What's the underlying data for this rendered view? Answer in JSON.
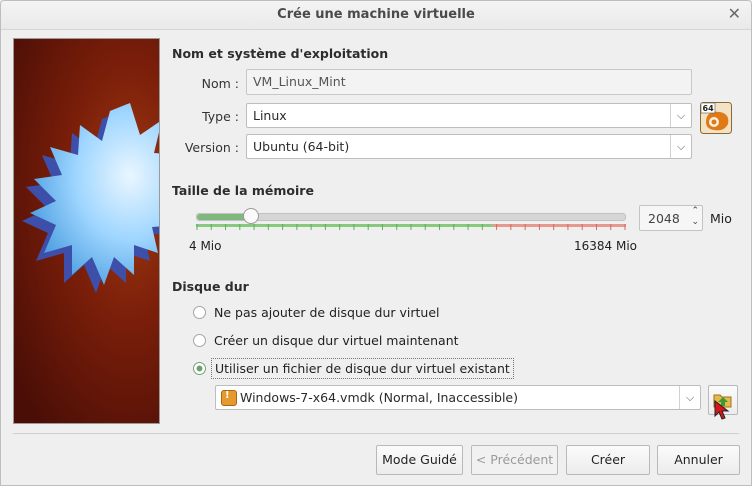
{
  "window": {
    "title": "Crée une machine virtuelle"
  },
  "sections": {
    "os": "Nom et système d'exploitation",
    "memory": "Taille de la mémoire",
    "disk": "Disque dur"
  },
  "name": {
    "label": "Nom :",
    "value": "VM_Linux_Mint"
  },
  "type": {
    "label": "Type :",
    "value": "Linux"
  },
  "version": {
    "label": "Version :",
    "value": "Ubuntu (64-bit)"
  },
  "os_badge": "64",
  "memory": {
    "value": "2048",
    "unit": "Mio",
    "min_label": "4 Mio",
    "max_label": "16384 Mio",
    "min": 4,
    "max": 16384,
    "level_fraction": 0.125
  },
  "disk": {
    "options": [
      "Ne pas ajouter de disque dur virtuel",
      "Créer un disque dur virtuel maintenant",
      "Utiliser un fichier de disque dur virtuel existant"
    ],
    "selected_index": 2,
    "file": "Windows-7-x64.vmdk (Normal, Inaccessible)"
  },
  "buttons": {
    "guided": "Mode Guidé",
    "previous": "< Précédent",
    "create": "Créer",
    "cancel": "Annuler"
  },
  "colors": {
    "slider_green": "#7fb87c",
    "tick_green": "#86c97f",
    "tick_red": "#e59a90",
    "sidebar_bg": "#7a1e0a"
  }
}
